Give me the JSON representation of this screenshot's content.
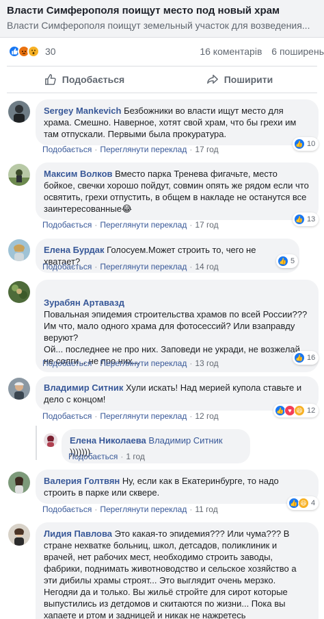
{
  "link": {
    "title": "Власти Симферополя поищут место под новый храм",
    "description": "Власти Симферополя поищут земельный участок для возведения..."
  },
  "stats": {
    "reaction_count": "30",
    "comments": "16 коментарів",
    "shares": "6 поширень"
  },
  "actions": {
    "like": "Подобається",
    "share": "Поширити"
  },
  "comments": [
    {
      "author": "Sergey Mankevich",
      "text": "Безбожники во власти ищут место для храма. Смешно. Наверное, хотят свой храм, что бы грехи им там отпускали. Первыми была прокуратура.",
      "like": "Подобається",
      "translate": "Переглянути переклад",
      "time": "17 год",
      "reactions": "10"
    },
    {
      "author": "Максим Волков",
      "text": "Вместо парка Тренева фигачьте, место бойкое, свечки хорошо пойдут, совмин опять же рядом если что освятить, грехи отпустить, в общем в накладе не останутся все заинтересованные😂",
      "like": "Подобається",
      "translate": "Переглянути переклад",
      "time": "17 год",
      "reactions": "13"
    },
    {
      "author": "Елена Бурдак",
      "text": "Голосуем.Может строить то, чего не хватает?",
      "like": "Подобається",
      "translate": "Переглянути переклад",
      "time": "14 год",
      "reactions": "5"
    },
    {
      "author": "Зурабян Артавазд",
      "text": "Повальная эпидемия строительства храмов по всей России???\nИм что, мало одного храма для фотосессий? Или взаправду веруют?\nОй... последнее не про них. Заповеди не укради, не возжелай, не солги... не про них...",
      "like": "Подобається",
      "translate": "Переглянути переклад",
      "time": "13 год",
      "reactions": "16"
    },
    {
      "author": "Владимир Ситник",
      "text": "Хули искать! Над мерией купола ставьте и дело с концом!",
      "like": "Подобається",
      "translate": "Переглянути переклад",
      "time": "12 год",
      "reactions": "12"
    },
    {
      "author": "Валерия Голтвян",
      "text": "Ну, если как в Екатеринбурге, то надо строить в парке или сквере.",
      "like": "Подобається",
      "translate": "Переглянути переклад",
      "time": "11 год",
      "reactions": "4"
    },
    {
      "author": "Лидия Павлова",
      "text": "Это какая-то эпидемия??? Или чума??? В стране нехватке больниц, школ, детсадов, поликлиник и врачей, нет рабочих мест, необходимо строить заводы, фабрики, поднимать животноводство и сельское хозяйство а эти дибилы храмы строят... Это выглядит очень мерзко. Негодяи да и только. Вы жильё стройте для сирот которые выпустились из детдомов и скитаются по жизни... Пока вы хапаете и ртом и задницей и никак не нажретесь"
    }
  ],
  "reply": {
    "author": "Елена Николаева",
    "mention": "Владимир Ситник",
    "text": " )))))))",
    "like": "Подобається",
    "time": "1 год"
  },
  "colors": {
    "link_blue": "#385898",
    "bubble_bg": "#f2f3f5",
    "like_blue": "#1877f2",
    "meta_grey": "#616770"
  }
}
